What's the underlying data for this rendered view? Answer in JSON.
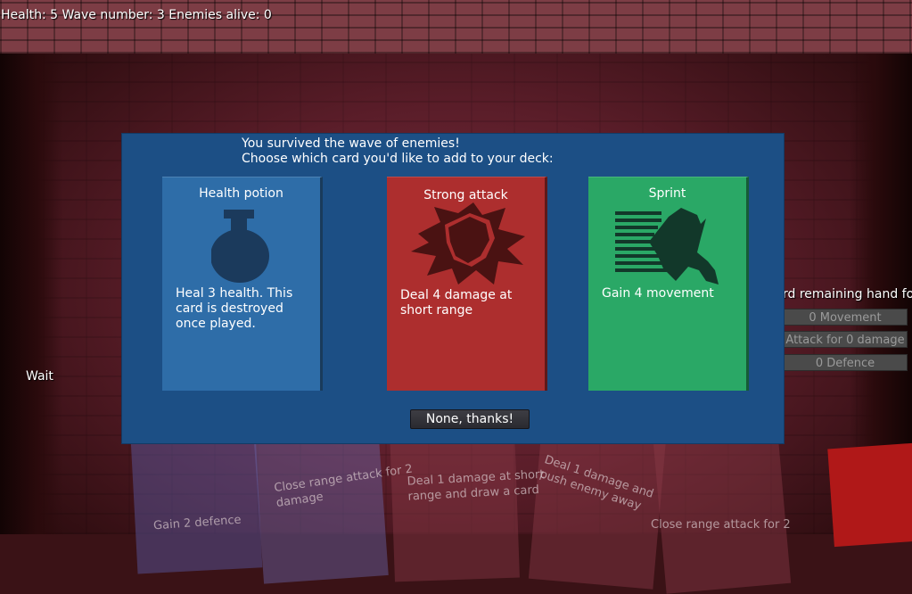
{
  "hud": {
    "status": "Health: 5 Wave number: 3 Enemies alive: 0"
  },
  "left": {
    "wait_label": "Wait"
  },
  "side_panel": {
    "title": "rd remaining hand for:",
    "buttons": [
      "0 Movement",
      "Attack for 0 damage",
      "0 Defence"
    ]
  },
  "hand": {
    "cards": [
      "Gain 2 defence",
      "Close range attack for 2 damage",
      "Deal 1 damage at short range and draw a card",
      "Deal 1 damage and push enemy away",
      "Close range attack for 2"
    ]
  },
  "modal": {
    "line1": "You survived the wave of enemies!",
    "line2": "Choose which card you'd like to add to your deck:",
    "cards": [
      {
        "title": "Health potion",
        "desc": "Heal 3 health. This card is destroyed once played.",
        "color": "#2e6da8",
        "icon": "potion-icon"
      },
      {
        "title": "Strong attack",
        "desc": "Deal 4 damage at short range",
        "color": "#ad2e2e",
        "icon": "fist-impact-icon"
      },
      {
        "title": "Sprint",
        "desc": "Gain 4 movement",
        "color": "#2aa866",
        "icon": "running-boot-icon"
      }
    ],
    "decline_label": "None, thanks!"
  }
}
